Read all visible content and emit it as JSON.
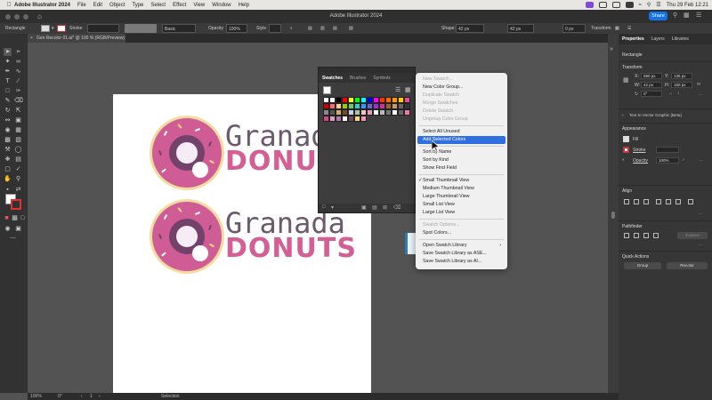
{
  "macmenu": {
    "app": "Adobe Illustrator 2024",
    "items": [
      "File",
      "Edit",
      "Object",
      "Type",
      "Select",
      "Effect",
      "View",
      "Window",
      "Help"
    ],
    "clock": "Thu 29 Feb  12:21"
  },
  "titlebar": {
    "title": "Adobe Illustrator 2024",
    "share": "Share"
  },
  "control": {
    "object_type": "Rectangle",
    "stroke_label": "Stroke",
    "basic_label": "Basic",
    "opacity_label": "Opacity",
    "opacity_value": "100%",
    "style_label": "Style",
    "shape_label": "Shape:",
    "shape_w": "42 px",
    "shape_h": "42 px",
    "corner": "0 px",
    "transform_label": "Transform"
  },
  "document": {
    "tab": "Gen Recolor 01.ai* @ 100 % (RGB/Preview)"
  },
  "artwork": {
    "brand_top": "Granada",
    "brand_bottom": "DONUTS",
    "colors": {
      "glaze": "#cf5c95",
      "dough": "#f3dca0",
      "hole": "#72426b",
      "text_dark": "#6a5a6a",
      "text_pink": "#d45f94"
    }
  },
  "swatches": {
    "tabs": [
      "Swatches",
      "Brushes",
      "Symbols"
    ],
    "colors": [
      "#ffffff",
      "#ffffff",
      "#000000",
      "#ff0000",
      "#ffff00",
      "#00ff00",
      "#00ffff",
      "#0000ff",
      "#ff00ff",
      "#ff3300",
      "#ff6600",
      "#ff9900",
      "#ffcc00",
      "#e84a93",
      "#cc0000",
      "#ff6666",
      "#ffcc99",
      "#99cc00",
      "#66cc66",
      "#33cccc",
      "#3399ff",
      "#6666cc",
      "#9933cc",
      "#cc3399",
      "#996633",
      "#cc9966",
      "#666666",
      "#333333",
      "#888888",
      "#555555",
      "#cfae6b",
      "#7a4b2a",
      "#c8d2e6",
      "#a9c4a0",
      "#f2c1d1",
      "#e89cb8",
      "#ffffff",
      "#bbbbbb",
      "#777777",
      "#ffffff",
      "#666666",
      "#ee7ca8",
      "#cc4b86",
      "#d9a0c0",
      "#b27aa5",
      "#ffffff",
      "#6c4a64",
      "#f5d87f",
      "#ee9aaa"
    ]
  },
  "context_menu": {
    "items": [
      {
        "label": "New Swatch...",
        "disabled": true
      },
      {
        "label": "New Color Group...",
        "disabled": false
      },
      {
        "label": "Duplicate Swatch",
        "disabled": true
      },
      {
        "label": "Merge Swatches",
        "disabled": true
      },
      {
        "label": "Delete Swatch",
        "disabled": true
      },
      {
        "label": "Ungroup Color Group",
        "disabled": true
      },
      {
        "label": "Select All Unused",
        "disabled": false
      },
      {
        "label": "Add Selected Colors",
        "disabled": false,
        "highlighted": true
      },
      {
        "label": "Sort by Name",
        "disabled": false
      },
      {
        "label": "Sort by Kind",
        "disabled": false
      },
      {
        "label": "Show Find Field",
        "disabled": false
      },
      {
        "label": "Small Thumbnail View",
        "disabled": false,
        "checked": true
      },
      {
        "label": "Medium Thumbnail View",
        "disabled": false
      },
      {
        "label": "Large Thumbnail View",
        "disabled": false
      },
      {
        "label": "Small List View",
        "disabled": false
      },
      {
        "label": "Large List View",
        "disabled": false
      },
      {
        "label": "Swatch Options...",
        "disabled": true
      },
      {
        "label": "Spot Colors...",
        "disabled": false
      },
      {
        "label": "Open Swatch Library",
        "disabled": false,
        "submenu": true
      },
      {
        "label": "Save Swatch Library as ASE...",
        "disabled": false
      },
      {
        "label": "Save Swatch Library as AI...",
        "disabled": false
      }
    ]
  },
  "properties": {
    "tabs": [
      "Properties",
      "Layers",
      "Libraries"
    ],
    "object": "Rectangle",
    "transform_title": "Transform",
    "x": "690 px",
    "y": "136 px",
    "w": "42 px",
    "h": "150 px",
    "rotate": "0°",
    "text_to_vector": "Text to Vector Graphic (Beta)",
    "appearance_title": "Appearance",
    "fill_label": "Fill",
    "stroke_label": "Stroke",
    "opacity_label": "Opacity",
    "opacity_value": "100%",
    "align_title": "Align",
    "pathfinder_title": "Pathfinder",
    "expand_label": "Expand",
    "quick_actions_title": "Quick Actions",
    "group_label": "Group",
    "recolor_label": "Recolor"
  },
  "status": {
    "zoom": "100%",
    "rotation": "0°",
    "page": "1",
    "tool": "Selection"
  }
}
